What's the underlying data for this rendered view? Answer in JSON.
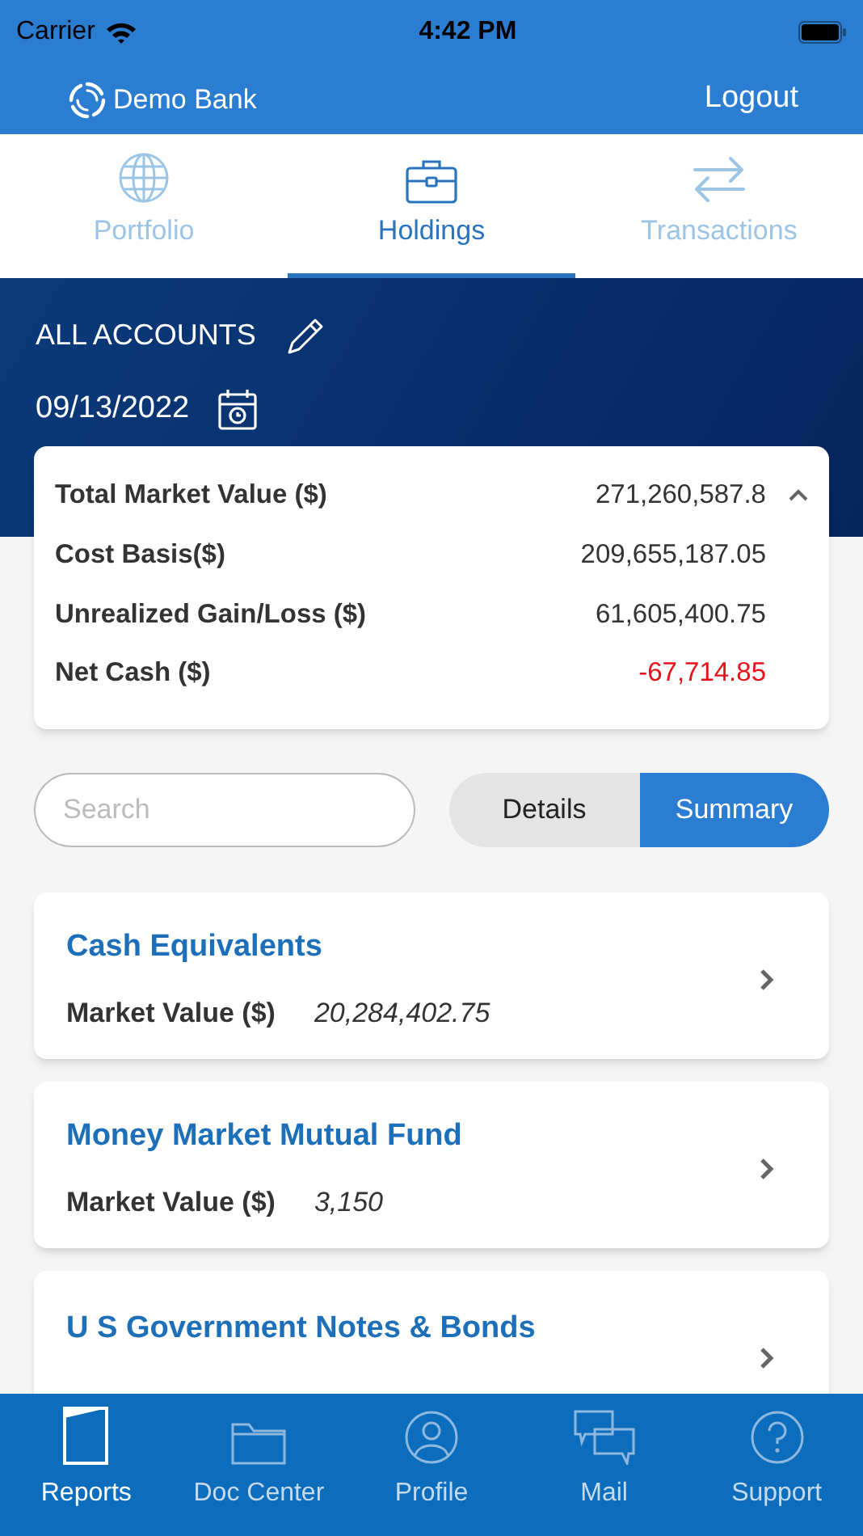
{
  "status_bar": {
    "carrier": "Carrier",
    "time": "4:42 PM"
  },
  "header": {
    "brand": "Demo Bank",
    "logout": "Logout"
  },
  "tabs": [
    {
      "label": "Portfolio",
      "selected": false
    },
    {
      "label": "Holdings",
      "selected": true
    },
    {
      "label": "Transactions",
      "selected": false
    }
  ],
  "account": {
    "name": "ALL ACCOUNTS",
    "date": "09/13/2022"
  },
  "summary": {
    "expanded": true,
    "rows": [
      {
        "label": "Total Market Value ($)",
        "value": "271,260,587.8",
        "negative": false
      },
      {
        "label": "Cost Basis($)",
        "value": "209,655,187.05",
        "negative": false
      },
      {
        "label": "Unrealized Gain/Loss ($)",
        "value": "61,605,400.75",
        "negative": false
      },
      {
        "label": "Net Cash ($)",
        "value": "-67,714.85",
        "negative": true
      }
    ]
  },
  "search": {
    "placeholder": "Search"
  },
  "view_toggle": [
    {
      "label": "Details",
      "selected": false
    },
    {
      "label": "Summary",
      "selected": true
    }
  ],
  "holdings": [
    {
      "title": "Cash Equivalents",
      "label": "Market Value ($)",
      "value": "20,284,402.75"
    },
    {
      "title": "Money Market Mutual Fund",
      "label": "Market Value ($)",
      "value": "3,150"
    },
    {
      "title": "U S Government Notes & Bonds"
    }
  ],
  "bottom_nav": [
    {
      "label": "Reports",
      "selected": true
    },
    {
      "label": "Doc Center",
      "selected": false
    },
    {
      "label": "Profile",
      "selected": false
    },
    {
      "label": "Mail",
      "selected": false
    },
    {
      "label": "Support",
      "selected": false
    }
  ]
}
